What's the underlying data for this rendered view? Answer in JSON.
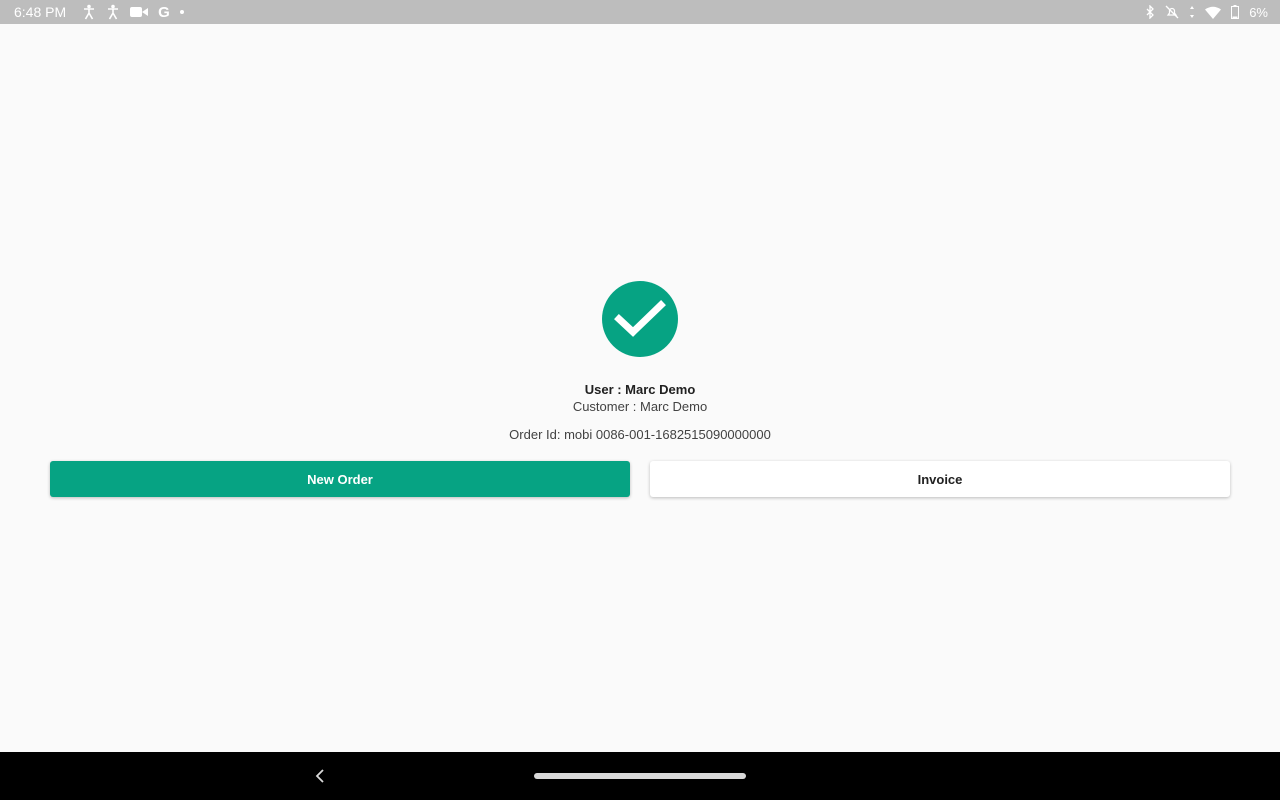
{
  "status_bar": {
    "time": "6:48 PM",
    "battery": "6%",
    "left_icons": [
      "accessibility-icon",
      "accessibility-icon",
      "video-camera-icon",
      "google-icon",
      "dot-icon"
    ],
    "right_icons": [
      "bluetooth-icon",
      "notifications-off-icon",
      "wifi-icon",
      "battery-icon"
    ],
    "google_letter": "G"
  },
  "result": {
    "icon": "check-circle-icon",
    "user": "User : Marc Demo",
    "customer": "Customer : Marc Demo",
    "order_id": "Order Id: mobi 0086-001-1682515090000000"
  },
  "actions": {
    "new_order_label": "New Order",
    "invoice_label": "Invoice"
  },
  "colors": {
    "accent": "#06a383",
    "status_bar": "#bdbdbd",
    "nav_bar": "#000000",
    "background": "#fafafa"
  },
  "nav_bar": {
    "icons": [
      "back-icon",
      "home-pill-icon"
    ]
  }
}
